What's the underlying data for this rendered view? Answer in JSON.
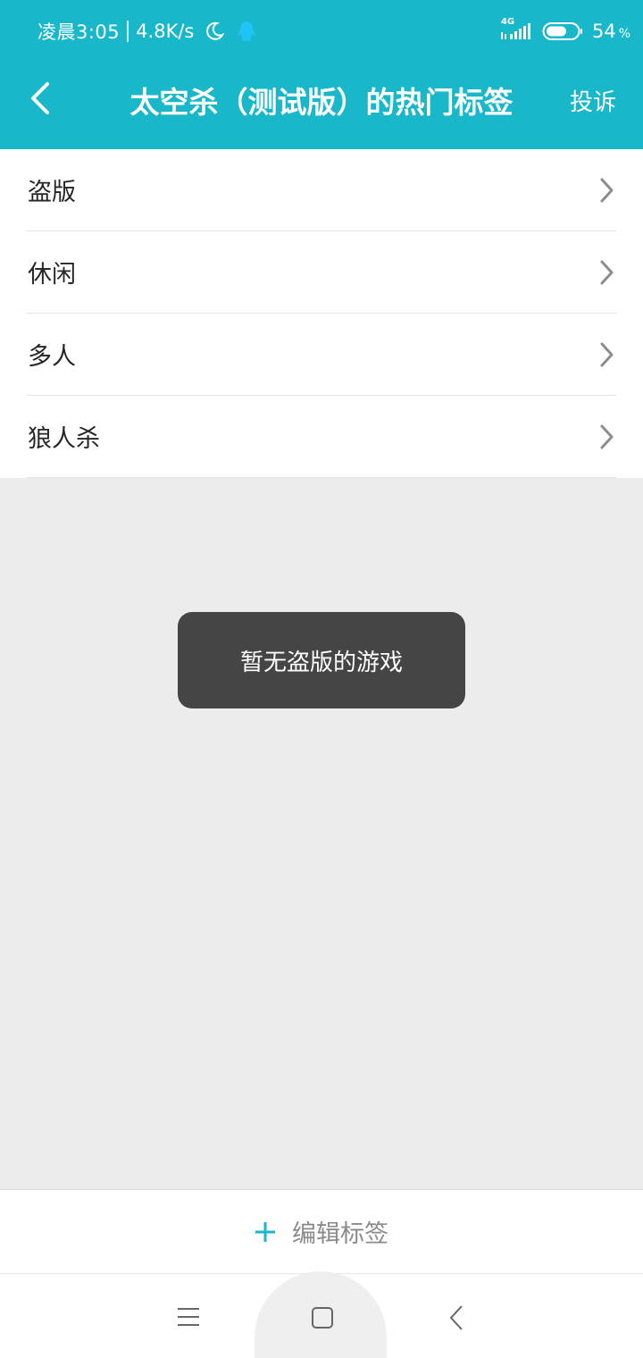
{
  "status_bar": {
    "time": "凌晨3:05",
    "net_speed": "4.8K/s",
    "network_type": "4G",
    "battery_percent": "54",
    "battery_unit": "%",
    "icons": [
      "moon-icon",
      "qq-icon",
      "signal-icon",
      "battery-icon"
    ]
  },
  "header": {
    "title": "太空杀（测试版）的热门标签",
    "report_label": "投诉",
    "back_icon": "back-arrow-icon"
  },
  "tags": [
    {
      "label": "盗版"
    },
    {
      "label": "休闲"
    },
    {
      "label": "多人"
    },
    {
      "label": "狼人杀"
    }
  ],
  "toast": {
    "message": "暂无盗版的游戏"
  },
  "edit_bar": {
    "label": "编辑标签",
    "icon": "plus-icon"
  },
  "nav_bar": {
    "icons": [
      "menu-icon",
      "home-icon",
      "back-icon"
    ]
  },
  "colors": {
    "accent": "#18b7c9",
    "background": "#ececec",
    "toast_bg": "#454545",
    "qq_icon": "#1ec4f5"
  }
}
